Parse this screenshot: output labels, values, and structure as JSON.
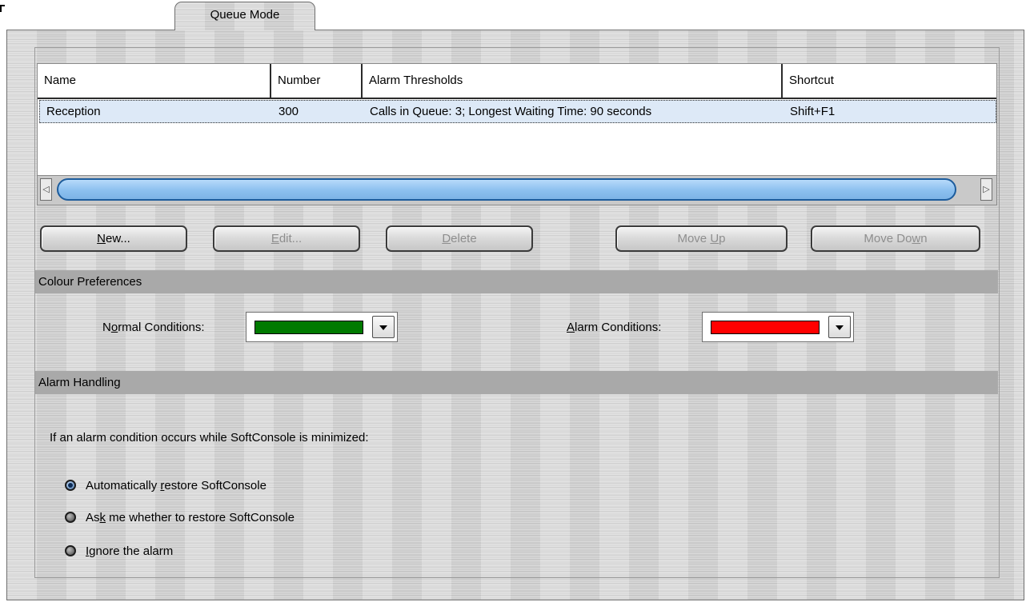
{
  "tab": {
    "label": "Queue Mode"
  },
  "queue_table": {
    "columns": [
      "Name",
      "Number",
      "Alarm Thresholds",
      "Shortcut"
    ],
    "rows": [
      {
        "name": "Reception",
        "number": "300",
        "thresholds": "Calls in Queue: 3; Longest Waiting Time: 90 seconds",
        "shortcut": "Shift+F1"
      }
    ]
  },
  "buttons": {
    "new": {
      "mn": "N",
      "rest": "ew..."
    },
    "edit": {
      "mn": "E",
      "rest": "dit..."
    },
    "delete": {
      "mn": "D",
      "rest": "elete"
    },
    "move_up": {
      "pre": "Move ",
      "mn": "U",
      "rest": "p"
    },
    "move_down": {
      "pre": "Move Do",
      "mn": "w",
      "rest": "n"
    }
  },
  "colour_preferences": {
    "title": "Colour Preferences",
    "normal": {
      "pre": "N",
      "mn": "o",
      "rest": "rmal Conditions:",
      "color": "#007a00"
    },
    "alarm": {
      "mn": "A",
      "rest": "larm Conditions:",
      "color": "#ff0000"
    }
  },
  "alarm_handling": {
    "title": "Alarm Handling",
    "prompt": "If an alarm condition occurs while SoftConsole is minimized:",
    "options": [
      {
        "pre": "Automatically ",
        "mn": "r",
        "rest": "estore SoftConsole",
        "checked": true
      },
      {
        "pre": "As",
        "mn": "k",
        "rest": " me whether to restore SoftConsole",
        "checked": false
      },
      {
        "pre": "",
        "mn": "I",
        "rest": "gnore the alarm",
        "checked": false
      }
    ]
  }
}
